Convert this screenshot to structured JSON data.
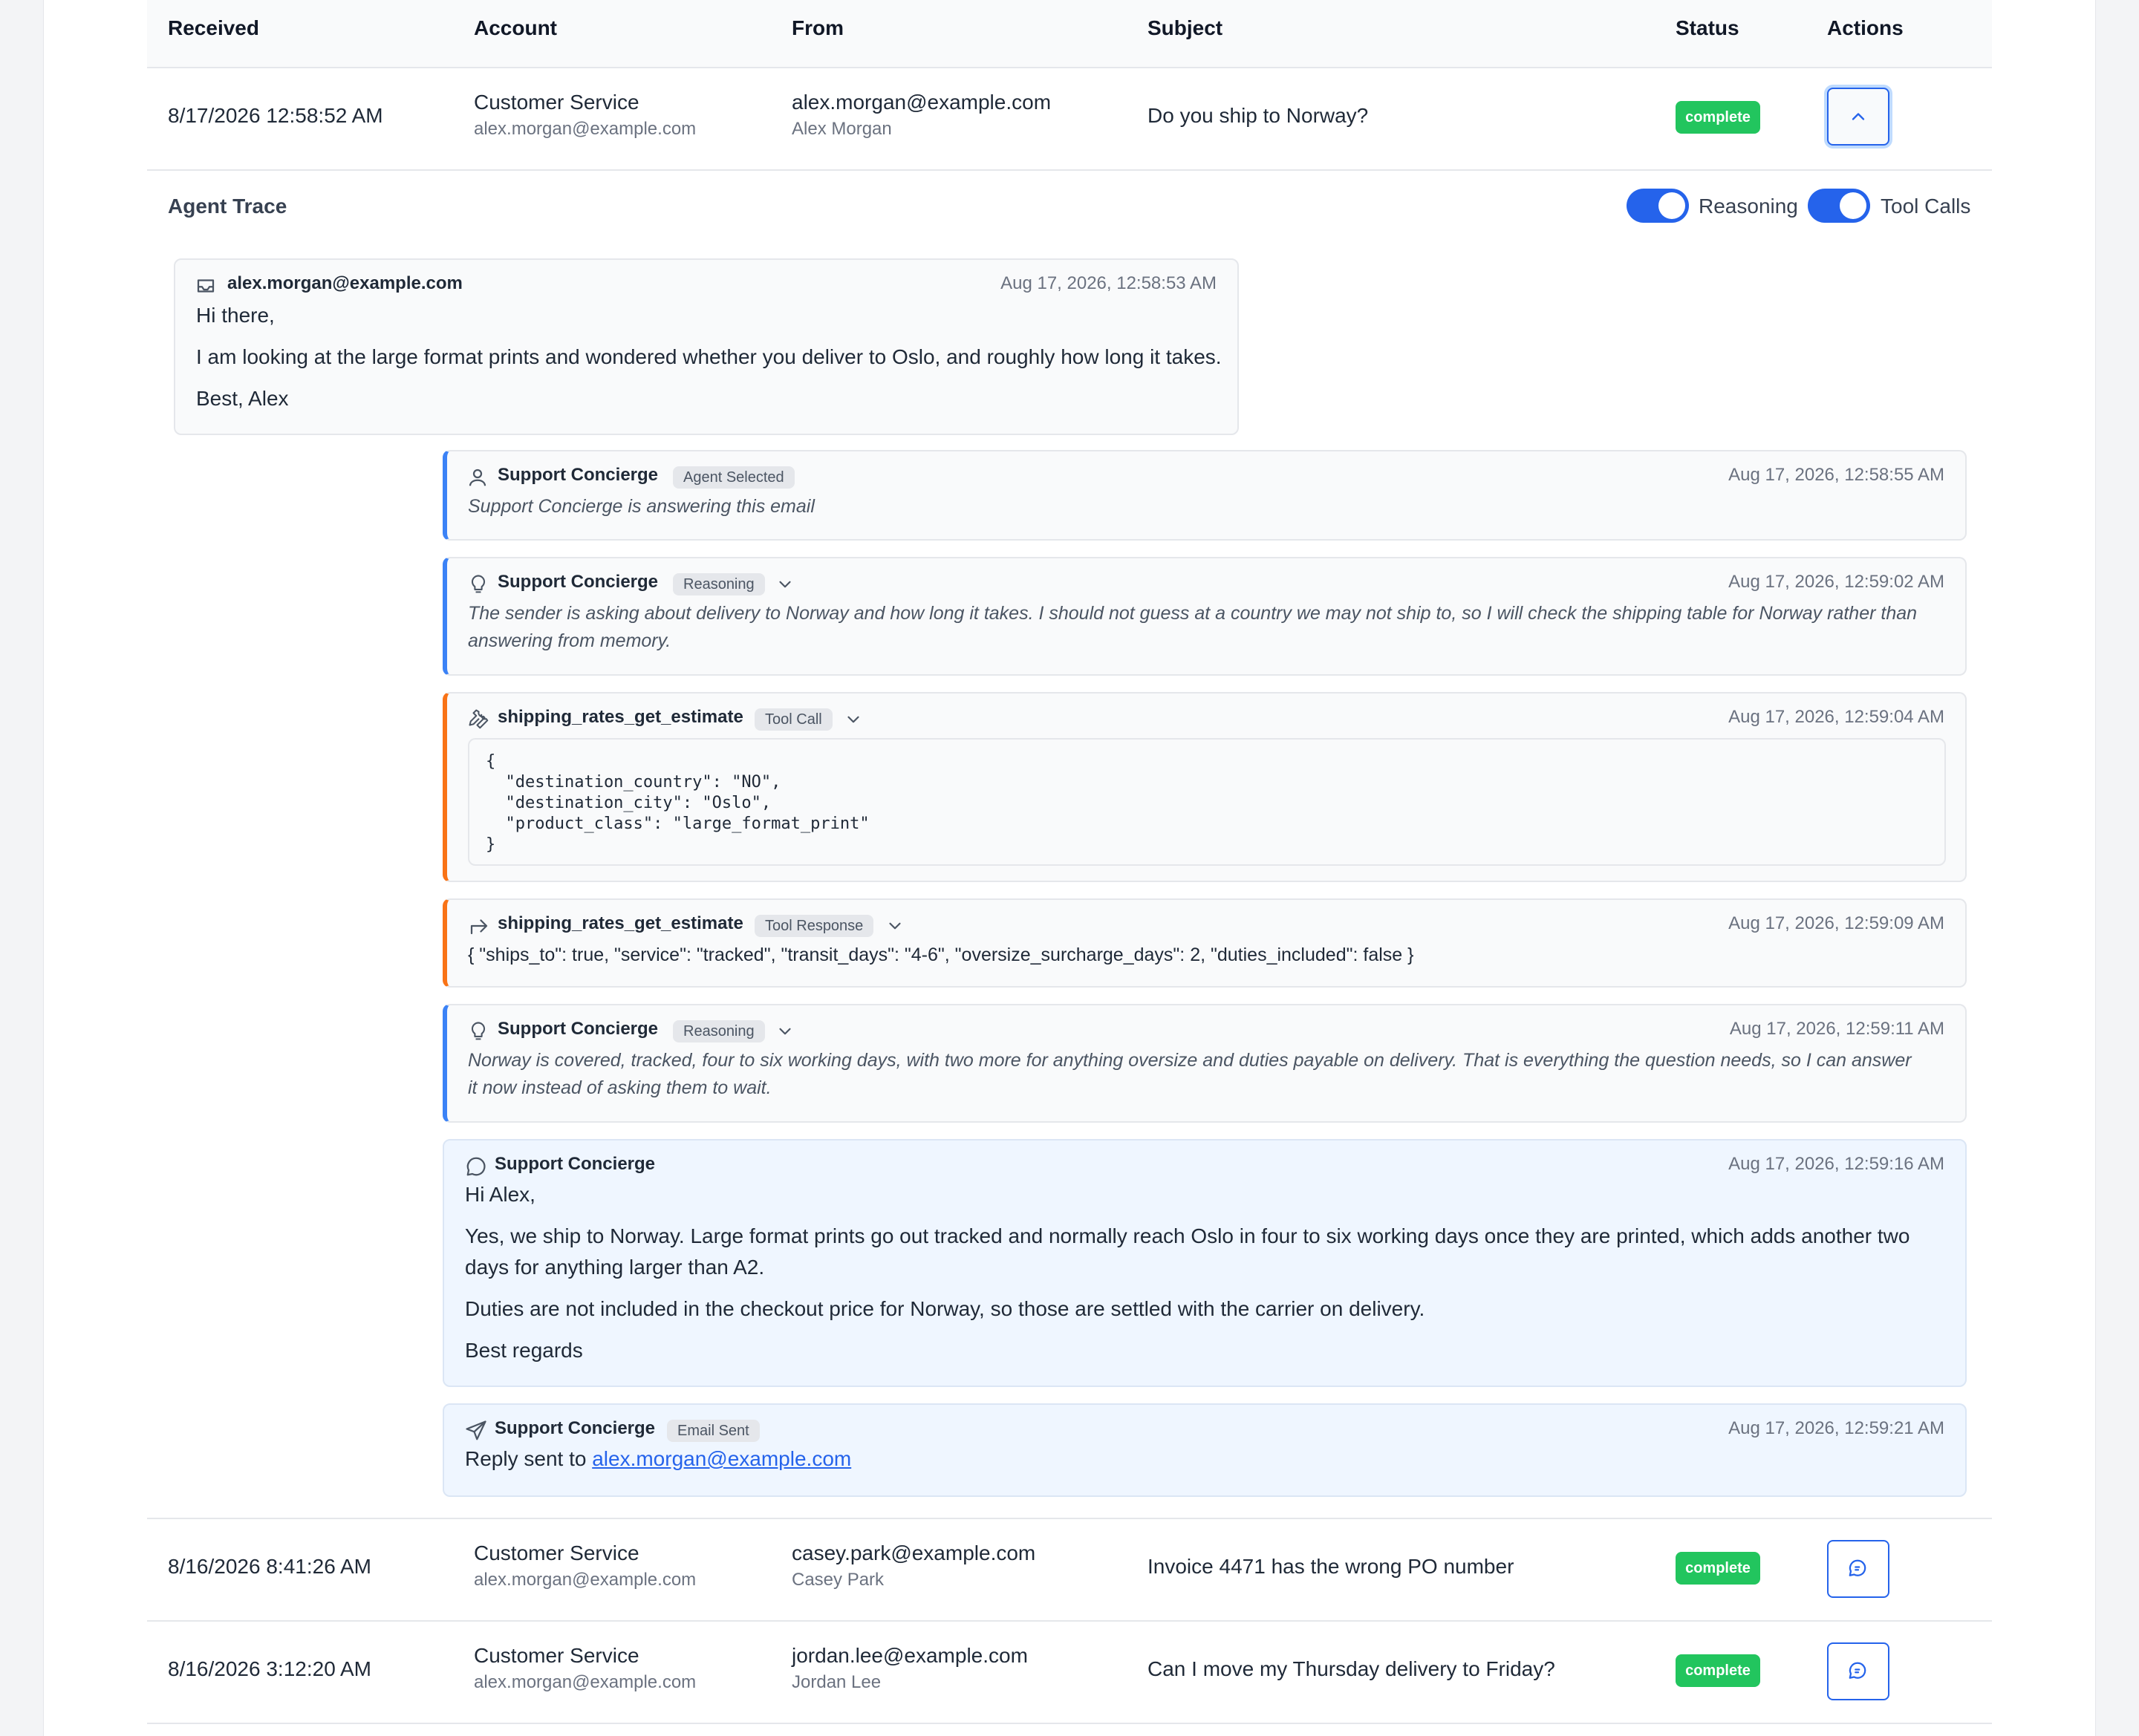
{
  "table": {
    "headers": {
      "received": "Received",
      "account": "Account",
      "from": "From",
      "subject": "Subject",
      "status": "Status",
      "actions": "Actions"
    },
    "rows": [
      {
        "received": "8/17/2026 12:58:52 AM",
        "account_name": "Customer Service",
        "account_email": "alex.morgan@example.com",
        "from_email": "alex.morgan@example.com",
        "from_name": "Alex Morgan",
        "subject": "Do you ship to Norway?",
        "status": "complete",
        "action_icon": "chevron-up-icon"
      },
      {
        "received": "8/16/2026 8:41:26 AM",
        "account_name": "Customer Service",
        "account_email": "alex.morgan@example.com",
        "from_email": "casey.park@example.com",
        "from_name": "Casey Park",
        "subject": "Invoice 4471 has the wrong PO number",
        "status": "complete",
        "action_icon": "chat-icon"
      },
      {
        "received": "8/16/2026 3:12:20 AM",
        "account_name": "Customer Service",
        "account_email": "alex.morgan@example.com",
        "from_email": "jordan.lee@example.com",
        "from_name": "Jordan Lee",
        "subject": "Can I move my Thursday delivery to Friday?",
        "status": "complete",
        "action_icon": "chat-icon"
      }
    ]
  },
  "trace": {
    "title": "Agent Trace",
    "toggles": {
      "reasoning": "Reasoning",
      "tool_calls": "Tool Calls",
      "reasoning_on": true,
      "tool_calls_on": true
    },
    "inbound": {
      "sender": "alex.morgan@example.com",
      "time": "Aug 17, 2026, 12:58:53 AM",
      "lines": [
        "Hi there,",
        "I am looking at the large format prints and wondered whether you deliver to Oslo, and roughly how long it takes.",
        "Best, Alex"
      ]
    },
    "events": {
      "agent_selected": {
        "title": "Support Concierge",
        "pill": "Agent Selected",
        "time": "Aug 17, 2026, 12:58:55 AM",
        "text": "Support Concierge is answering this email"
      },
      "reasoning1": {
        "title": "Support Concierge",
        "pill": "Reasoning",
        "time": "Aug 17, 2026, 12:59:02 AM",
        "text": "The sender is asking about delivery to Norway and how long it takes. I should not guess at a country we may not ship to, so I will check the shipping table for Norway rather than answering from memory."
      },
      "tool_call": {
        "title": "shipping_rates_get_estimate",
        "pill": "Tool Call",
        "time": "Aug 17, 2026, 12:59:04 AM",
        "code": "{\n  \"destination_country\": \"NO\",\n  \"destination_city\": \"Oslo\",\n  \"product_class\": \"large_format_print\"\n}"
      },
      "tool_response": {
        "title": "shipping_rates_get_estimate",
        "pill": "Tool Response",
        "time": "Aug 17, 2026, 12:59:09 AM",
        "text": "{ \"ships_to\": true, \"service\": \"tracked\", \"transit_days\": \"4-6\", \"oversize_surcharge_days\": 2, \"duties_included\": false }"
      },
      "reasoning2": {
        "title": "Support Concierge",
        "pill": "Reasoning",
        "time": "Aug 17, 2026, 12:59:11 AM",
        "text": "Norway is covered, tracked, four to six working days, with two more for anything oversize and duties payable on delivery. That is everything the question needs, so I can answer it now instead of asking them to wait."
      },
      "reply": {
        "title": "Support Concierge",
        "time": "Aug 17, 2026, 12:59:16 AM",
        "lines": [
          "Hi Alex,",
          "Yes, we ship to Norway. Large format prints go out tracked and normally reach Oslo in four to six working days once they are printed, which adds another two days for anything larger than A2.",
          "Duties are not included in the checkout price for Norway, so those are settled with the carrier on delivery.",
          "Best regards"
        ]
      },
      "sent": {
        "title": "Support Concierge",
        "pill": "Email Sent",
        "time": "Aug 17, 2026, 12:59:21 AM",
        "prefix": "Reply sent to ",
        "link": "alex.morgan@example.com"
      }
    }
  },
  "colors": {
    "accent": "#2563eb",
    "complete": "#22c55e",
    "reasoning_border": "#3b82f6",
    "tool_border": "#f97316"
  }
}
